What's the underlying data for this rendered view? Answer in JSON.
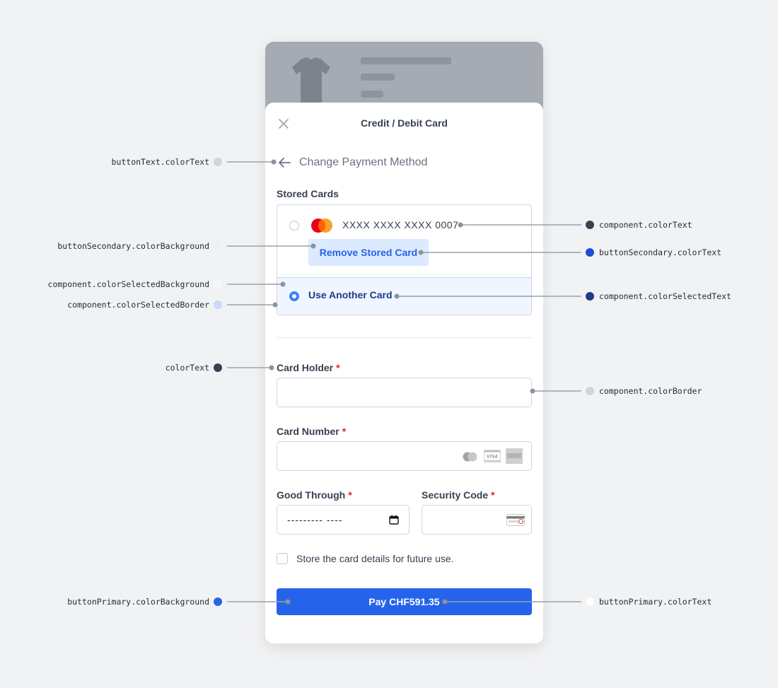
{
  "sheet": {
    "title": "Credit / Debit Card",
    "close_icon": "close-icon",
    "change_payment_label": "Change Payment Method"
  },
  "stored_cards": {
    "label": "Stored Cards",
    "card": {
      "brand_icon": "mastercard-icon",
      "number": "XXXX XXXX XXXX 0007",
      "selected": false
    },
    "remove_label": "Remove Stored Card",
    "use_another_label": "Use Another Card",
    "use_another_selected": true
  },
  "form": {
    "card_holder": {
      "label": "Card Holder",
      "required_mark": "*",
      "value": ""
    },
    "card_number": {
      "label": "Card Number",
      "required_mark": "*",
      "value": "",
      "brand_icons": [
        "mastercard-icon",
        "visa-icon",
        "amex-icon"
      ]
    },
    "good_through": {
      "label": "Good Through",
      "required_mark": "*",
      "placeholder": "--------- ----",
      "icon": "calendar-icon"
    },
    "security_code": {
      "label": "Security Code",
      "required_mark": "*",
      "value": "",
      "icon": "cvc-card-icon"
    },
    "store_details_label": "Store the card details for future use.",
    "store_details_checked": false
  },
  "pay_button": {
    "label": "Pay CHF591.35"
  },
  "annotations": {
    "left": [
      {
        "text": "buttonText.colorText",
        "dot": "#d1d5db"
      },
      {
        "text": "buttonSecondary.colorBackground",
        "dot": "#e8efff"
      },
      {
        "text": "component.colorSelectedBackground",
        "dot": "#f4f6fb"
      },
      {
        "text": "component.colorSelectedBorder",
        "dot": "#c7dbfb"
      },
      {
        "text": "colorText",
        "dot": "#374151"
      },
      {
        "text": "buttonPrimary.colorBackground",
        "dot": "#2563eb"
      }
    ],
    "right": [
      {
        "text": "component.colorText",
        "dot": "#374151"
      },
      {
        "text": "buttonSecondary.colorText",
        "dot": "#1d4ed8"
      },
      {
        "text": "component.colorSelectedText",
        "dot": "#1e3a8a"
      },
      {
        "text": "component.colorBorder",
        "dot": "#d1d5db"
      },
      {
        "text": "buttonPrimary.colorText",
        "dot": "#ffffff"
      }
    ]
  },
  "colors": {
    "background": "#f1f2f4",
    "primary": "#2563eb",
    "secondary_bg": "#dbeafe",
    "selected_bg": "#eff6ff",
    "selected_border": "#bfdbfe",
    "text": "#374151",
    "border": "#d1d5db"
  }
}
